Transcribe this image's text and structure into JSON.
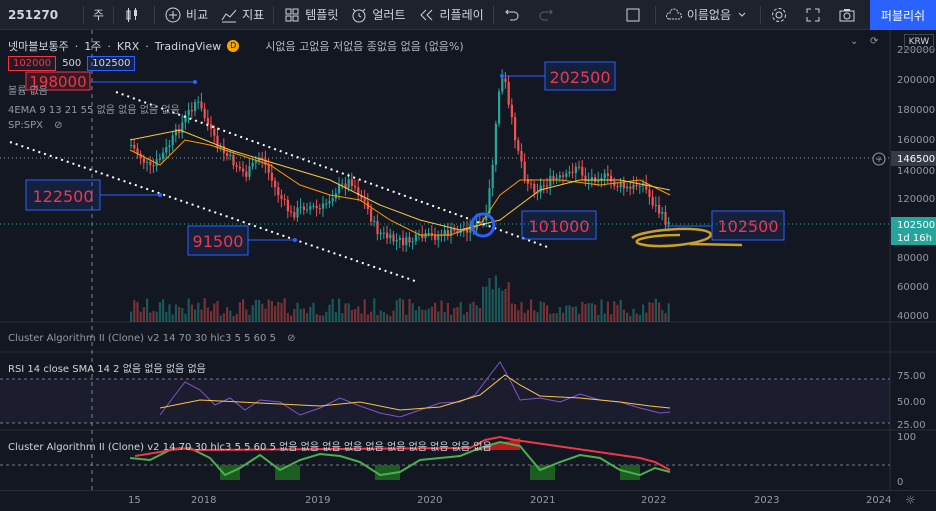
{
  "toolbar": {
    "symbol": "251270",
    "interval": "주",
    "compare": "비교",
    "indicators": "지표",
    "templates": "템플릿",
    "alert": "얼러트",
    "replay": "리플레이",
    "layout_name": "이름없음",
    "publish": "퍼블리쉬"
  },
  "legend": {
    "name": "넷마블보통주",
    "interval": "1주",
    "exchange": "KRX",
    "source": "TradingView",
    "badge": "D",
    "ohlc": "시없음 고없음 저없음 종없음 없음 (없음%)",
    "currency": "KRW"
  },
  "price_boxes": {
    "bid": "102000",
    "spread": "500",
    "ask": "102500"
  },
  "indicators": {
    "volume": "볼륨 없음",
    "ema": "4EMA 9 13 21 55 없음 없음 없음 없음",
    "spx": "SP:SPX",
    "cluster1": "Cluster Algorithm II (Clone) v2 14 70 30 hlc3 5 5 60 5",
    "rsi": "RSI 14 close SMA 14 2 없음 없음 없음 없음",
    "cluster2": "Cluster Algorithm II (Clone) v2 14 70 30 hlc3 5 5 60 5 없음 없음 없음 없음 없음 없음 없음 없음 없음 없음"
  },
  "annotations": {
    "high_left": "198000",
    "left_mid": "122500",
    "low_left": "91500",
    "peak": "202500",
    "circle_level": "101000",
    "current": "102500"
  },
  "price_axis": {
    "ticks": [
      "220000",
      "200000",
      "180000",
      "160000",
      "140000",
      "120000",
      "80000",
      "60000",
      "40000"
    ],
    "marker_146500": "146500",
    "current_price": "102500",
    "countdown": "1d 16h"
  },
  "rsi_axis": {
    "ticks": [
      "75.00",
      "50.00",
      "25.00"
    ]
  },
  "cluster_axis": {
    "ticks": [
      "100",
      "0"
    ]
  },
  "time_axis": {
    "labels": [
      "15",
      "2018",
      "2019",
      "2020",
      "2021",
      "2022",
      "2023",
      "2024"
    ]
  },
  "colors": {
    "background": "#131722",
    "up": "#26a69a",
    "down": "#ef5350",
    "accent": "#2962ff",
    "annotation_border": "#2962ff",
    "annotation_text": "#f23645"
  }
}
